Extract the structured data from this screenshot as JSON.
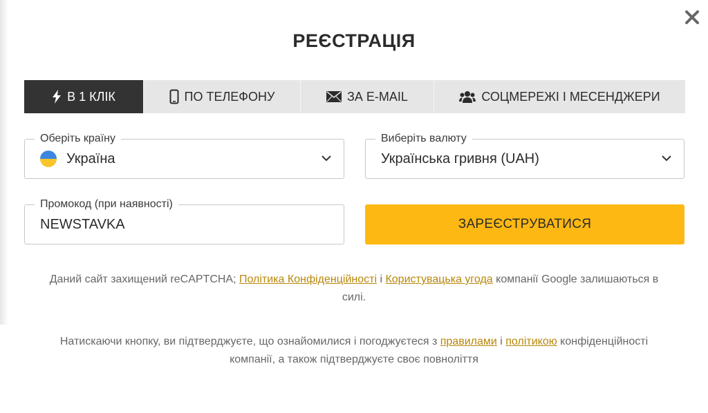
{
  "modal": {
    "title": "РЕЄСТРАЦІЯ",
    "close_icon": "close-icon"
  },
  "tabs": [
    {
      "label": "В 1 КЛІК",
      "icon": "lightning-icon",
      "active": true
    },
    {
      "label": "ПО ТЕЛЕФОНУ",
      "icon": "phone-icon",
      "active": false
    },
    {
      "label": "ЗА E-MAIL",
      "icon": "envelope-icon",
      "active": false
    },
    {
      "label": "СОЦМЕРЕЖІ І МЕСЕНДЖЕРИ",
      "icon": "users-icon",
      "active": false
    }
  ],
  "form": {
    "country": {
      "legend": "Оберіть країну",
      "value": "Україна",
      "flag": "ukraine-flag"
    },
    "currency": {
      "legend": "Виберіть валюту",
      "value": "Українська гривня (UAH)"
    },
    "promo": {
      "legend": "Промокод (при наявності)",
      "value": "NEWSTAVKA"
    },
    "submit_label": "ЗАРЕЄСТРУВАТИСЯ"
  },
  "recaptcha_note": {
    "text1": "Даний сайт захищений reCAPTCHA; ",
    "link1": "Політика Конфіденційності",
    "text2": " і ",
    "link2": "Користувацька угода",
    "text3": " компанії Google залишаються в силі."
  },
  "terms_note": {
    "text1": "Натискаючи кнопку, ви підтверджуєте, що ознайомилися і погоджуєтеся з ",
    "link1": "правилами",
    "text2": " і ",
    "link2": "політикою",
    "text3": " конфіденційності компанії, а також підтверджуєте своє повноліття"
  },
  "colors": {
    "accent": "#fdb813",
    "active_tab": "#333333",
    "link": "#b8870a"
  }
}
